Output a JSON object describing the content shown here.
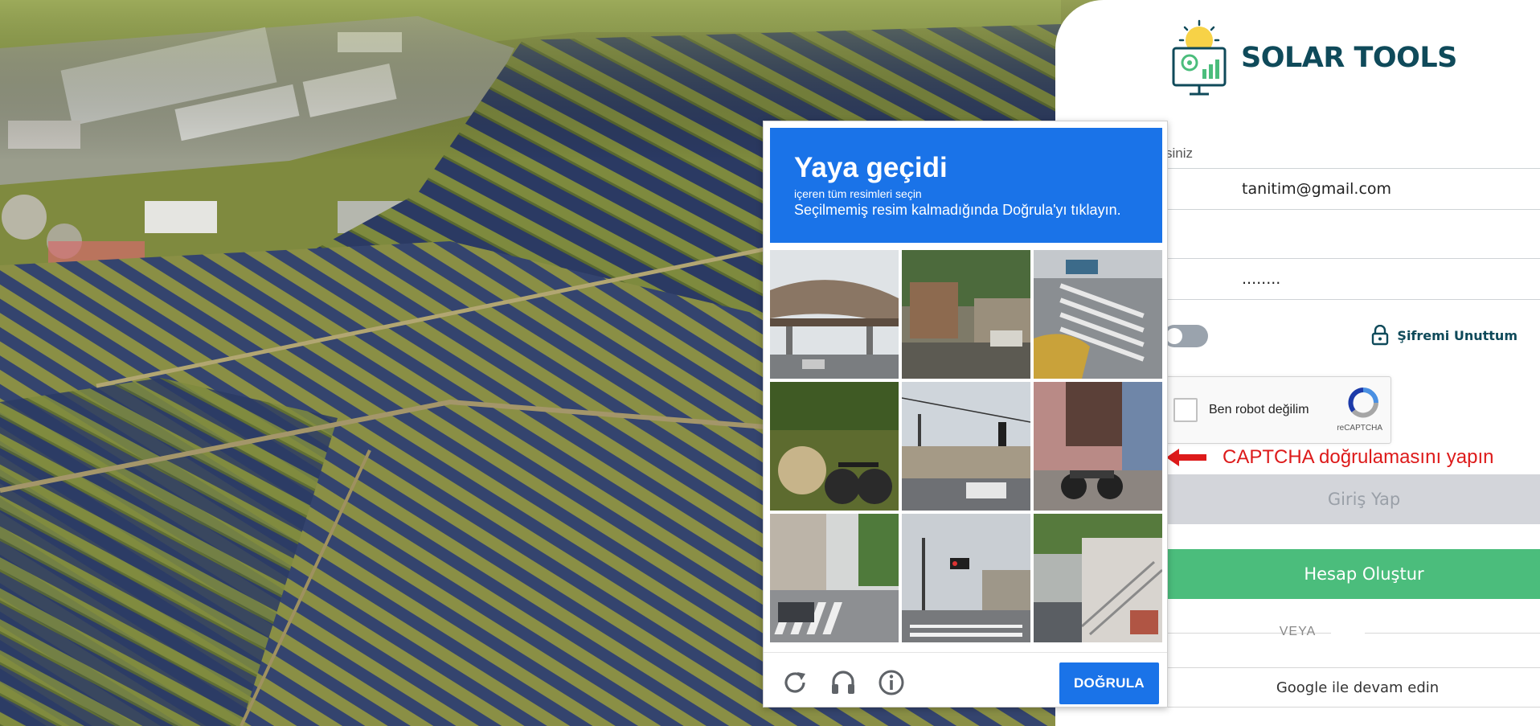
{
  "brand": {
    "name": "SOLAR TOOLS"
  },
  "login": {
    "email_label_partial": "siniz",
    "email_value_partial": "tanitim@gmail.com",
    "password_mask": "........",
    "forgot_label": "Şifremi Unuttum",
    "recaptcha_label": "Ben robot değilim",
    "recaptcha_brand": "reCAPTCHA",
    "captcha_hint": "CAPTCHA doğrulamasını yapın",
    "login_button": "Giriş Yap",
    "create_account_button": "Hesap Oluştur",
    "or_divider": "VEYA",
    "google_button": "Google ile devam edin"
  },
  "challenge": {
    "title": "Yaya geçidi",
    "subtitle": "içeren tüm resimleri seçin",
    "instruction": "Seçilmemiş resim kalmadığında Doğrula'yı tıklayın.",
    "verify_button": "DOĞRULA",
    "footer_icons": [
      "reload-icon",
      "headphones-icon",
      "info-icon"
    ]
  },
  "colors": {
    "brand_dark": "#0f4a5a",
    "challenge_blue": "#1a73e8",
    "create_green": "#4bbd7c",
    "hint_red": "#dd1a1a",
    "disabled_gray": "#d3d5da"
  }
}
